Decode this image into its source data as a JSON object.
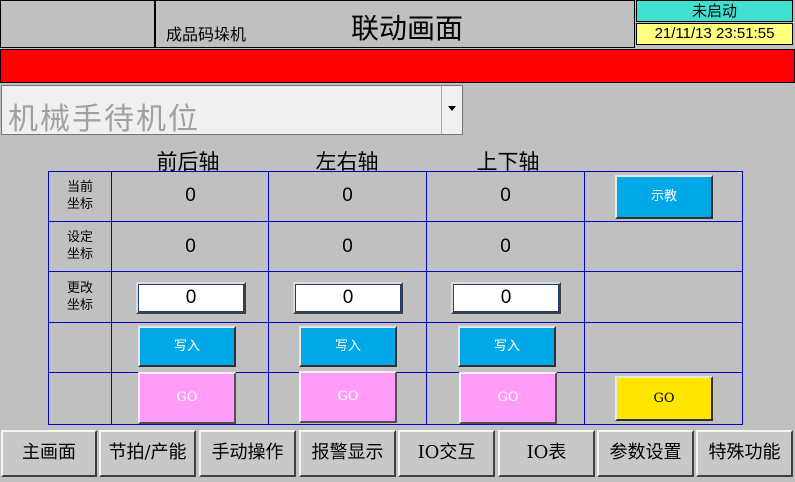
{
  "header": {
    "machine_name": "成品码垛机",
    "screen_title": "联动画面",
    "status": "未启动",
    "datetime": "21/11/13 23:51:55"
  },
  "colors": {
    "alarm_bar": "#ff0000",
    "status_bg": "#40e0d0",
    "datetime_bg": "#ffff80",
    "button_blue": "#00a8e8",
    "button_pink": "#ff9cf8",
    "button_yellow": "#ffe600",
    "grid_line": "#0000c8"
  },
  "position_select": {
    "selected": "机械手待机位"
  },
  "axes": [
    "前后轴",
    "左右轴",
    "上下轴"
  ],
  "rows": {
    "current": {
      "label_line1": "当前",
      "label_line2": "坐标",
      "values": [
        "0",
        "0",
        "0"
      ]
    },
    "setpoint": {
      "label_line1": "设定",
      "label_line2": "坐标",
      "values": [
        "0",
        "0",
        "0"
      ]
    },
    "modify": {
      "label_line1": "更改",
      "label_line2": "坐标",
      "values": [
        "0",
        "0",
        "0"
      ]
    }
  },
  "buttons": {
    "teach": "示教",
    "write": "写入",
    "go": "GO"
  },
  "nav": [
    "主画面",
    "节拍/产能",
    "手动操作",
    "报警显示",
    "IO交互",
    "IO表",
    "参数设置",
    "特殊功能"
  ]
}
